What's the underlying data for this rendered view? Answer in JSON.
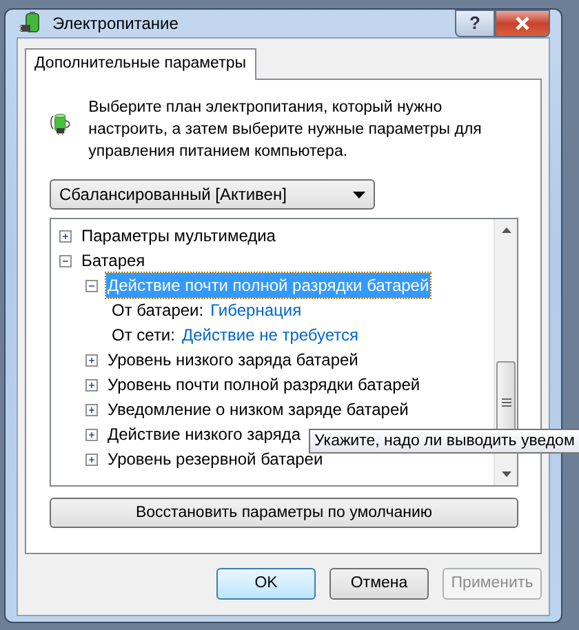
{
  "window": {
    "title": "Электропитание",
    "buttons": [
      {
        "kind": "help",
        "label": "?"
      },
      {
        "kind": "close"
      }
    ]
  },
  "tabs": [
    {
      "label": "Дополнительные параметры",
      "selected": true
    }
  ],
  "description": "Выберите план электропитания, который нужно настроить, а затем выберите нужные параметры для управления питанием компьютера.",
  "plan_dropdown": {
    "value": "Сбалансированный [Активен]"
  },
  "tree": [
    {
      "kind": "node",
      "label": "Параметры мультимедиа",
      "expanded": false,
      "selected": false
    },
    {
      "kind": "node",
      "label": "Батарея",
      "expanded": true,
      "selected": false,
      "children": [
        {
          "kind": "node",
          "label": "Действие почти полной разрядки батарей",
          "expanded": true,
          "selected": true,
          "children": [
            {
              "kind": "setting",
              "label": "От батареи:",
              "value": "Гибернация"
            },
            {
              "kind": "setting",
              "label": "От сети:",
              "value": "Действие не требуется"
            }
          ]
        },
        {
          "kind": "node",
          "label": "Уровень низкого заряда батарей",
          "expanded": false,
          "selected": false
        },
        {
          "kind": "node",
          "label": "Уровень почти полной разрядки батарей",
          "expanded": false,
          "selected": false
        },
        {
          "kind": "node",
          "label": "Уведомление о низком заряде батарей",
          "expanded": false,
          "selected": false
        },
        {
          "kind": "node",
          "label": "Действие низкого заряда",
          "expanded": false,
          "selected": false
        },
        {
          "kind": "node",
          "label": "Уровень резервной батареи",
          "expanded": false,
          "selected": false
        }
      ]
    }
  ],
  "tooltip": "Укажите, надо ли выводить уведом",
  "restore_button": "Восстановить параметры по умолчанию",
  "footer_buttons": [
    {
      "label": "OK",
      "default": true,
      "disabled": false
    },
    {
      "label": "Отмена",
      "default": false,
      "disabled": false
    },
    {
      "label": "Применить",
      "default": false,
      "disabled": true
    }
  ]
}
